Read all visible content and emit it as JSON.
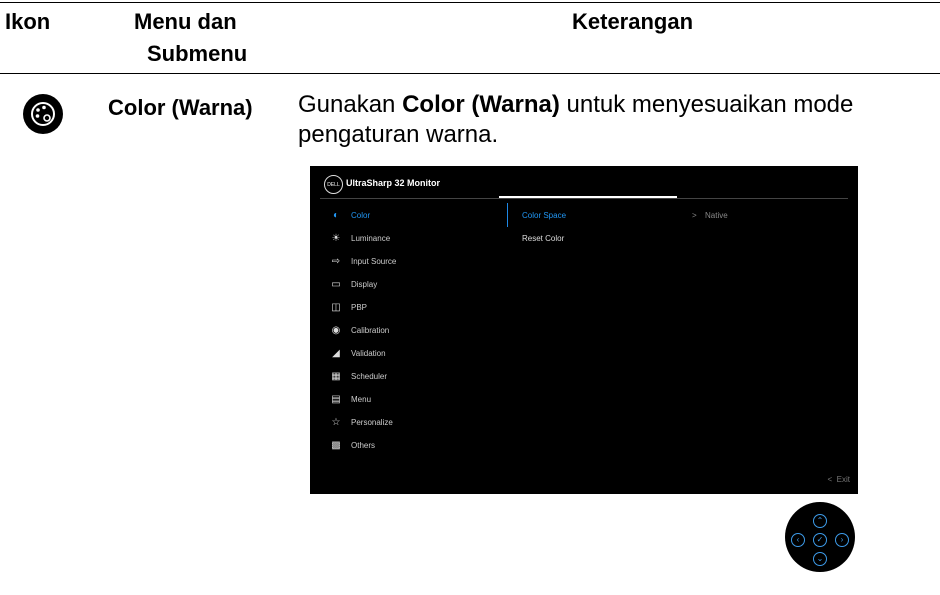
{
  "header": {
    "col1": "Ikon",
    "col2_line1": "Menu dan",
    "col2_line2": "Submenu",
    "col3": "Keterangan"
  },
  "row": {
    "icon": "color-palette-icon",
    "menu_label": "Color (Warna)",
    "desc_pre": "Gunakan ",
    "desc_bold": "Color (Warna)",
    "desc_post": " untuk menyesuaikan mode",
    "desc_line2": "pengaturan warna."
  },
  "osd": {
    "title": "UltraSharp 32 Monitor",
    "logo": "DELL",
    "menu": [
      {
        "label": "Color",
        "icon": "color-icon"
      },
      {
        "label": "Luminance",
        "icon": "brightness-icon"
      },
      {
        "label": "Input Source",
        "icon": "input-icon"
      },
      {
        "label": "Display",
        "icon": "display-icon"
      },
      {
        "label": "PBP",
        "icon": "pbp-icon"
      },
      {
        "label": "Calibration",
        "icon": "calibration-icon"
      },
      {
        "label": "Validation",
        "icon": "validation-icon"
      },
      {
        "label": "Scheduler",
        "icon": "scheduler-icon"
      },
      {
        "label": "Menu",
        "icon": "menu-icon"
      },
      {
        "label": "Personalize",
        "icon": "star-icon"
      },
      {
        "label": "Others",
        "icon": "others-icon"
      }
    ],
    "submenu": [
      "Color Space",
      "Reset Color"
    ],
    "value": "Native",
    "value_arrow": ">",
    "exit": "Exit",
    "exit_arrow": "<",
    "accent": "#2196f3"
  }
}
